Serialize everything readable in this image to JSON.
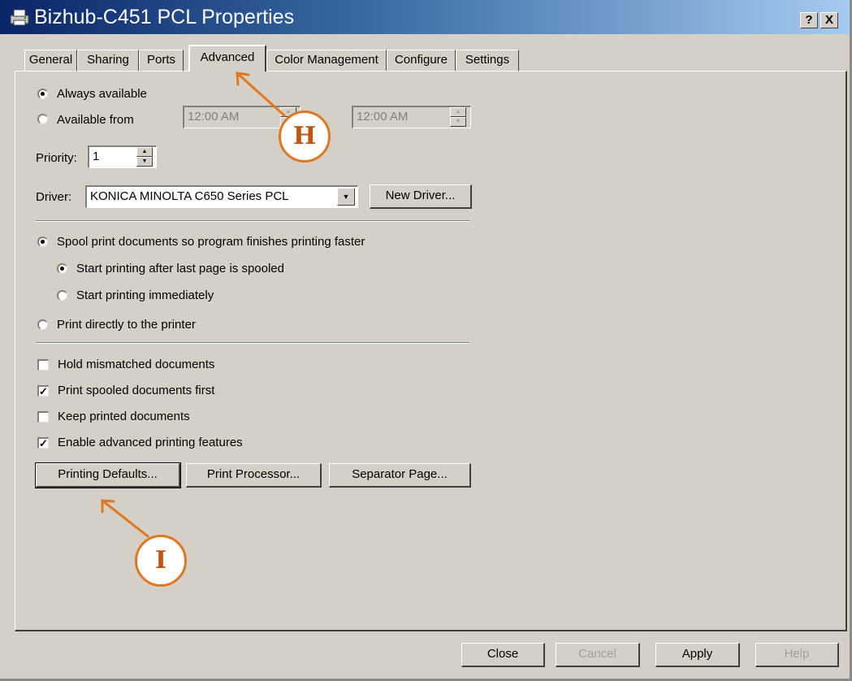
{
  "window": {
    "title": "Bizhub-C451 PCL Properties",
    "help_glyph": "?",
    "close_glyph": "X"
  },
  "tabs": [
    {
      "label": "General"
    },
    {
      "label": "Sharing"
    },
    {
      "label": "Ports"
    },
    {
      "label": "Advanced",
      "active": true
    },
    {
      "label": "Color Management"
    },
    {
      "label": "Configure"
    },
    {
      "label": "Settings"
    }
  ],
  "availability": {
    "always_label": "Always available",
    "from_label": "Available from",
    "selected": "always",
    "from_time": "12:00 AM",
    "to_time": "12:00 AM"
  },
  "priority": {
    "label": "Priority:",
    "value": "1"
  },
  "driver": {
    "label": "Driver:",
    "value": "KONICA MINOLTA C650 Series PCL",
    "new_driver_button": "New Driver..."
  },
  "spooling": {
    "spool_label": "Spool print documents so program finishes printing faster",
    "after_last_page_label": "Start printing after last page is spooled",
    "immediately_label": "Start printing immediately",
    "direct_label": "Print directly to the printer",
    "selected": "spool",
    "start_mode": "after_last_page"
  },
  "options": [
    {
      "label": "Hold mismatched documents",
      "checked": false
    },
    {
      "label": "Print spooled documents first",
      "checked": true
    },
    {
      "label": "Keep printed documents",
      "checked": false
    },
    {
      "label": "Enable advanced printing features",
      "checked": true
    }
  ],
  "action_buttons": {
    "printing_defaults": "Printing Defaults...",
    "print_processor": "Print Processor...",
    "separator_page": "Separator Page..."
  },
  "footer": {
    "close": "Close",
    "cancel": "Cancel",
    "apply": "Apply",
    "help": "Help"
  },
  "callouts": {
    "h": "H",
    "i": "I"
  },
  "colors": {
    "callout_accent": "#e07820",
    "titlebar_start": "#0a246a",
    "dialog_face": "#d4d0c8"
  }
}
